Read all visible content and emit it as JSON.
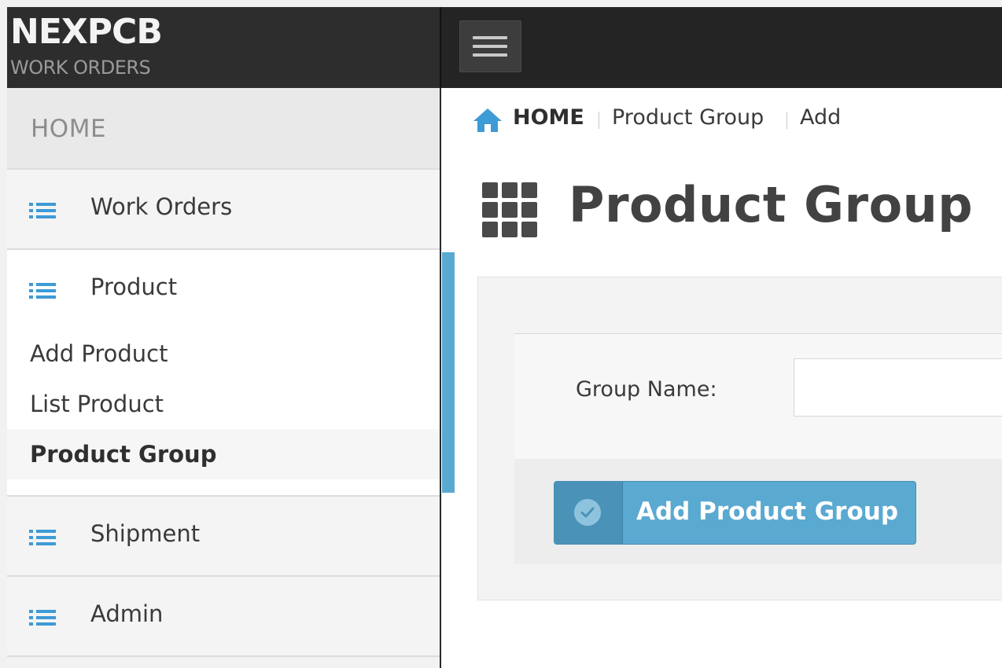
{
  "brand": {
    "name": "NEXPCB",
    "subtitle": "WORK ORDERS"
  },
  "breadcrumb": {
    "home": "HOME",
    "section": "Product Group",
    "action": "Add"
  },
  "sidebar": {
    "home_label": "HOME",
    "items": [
      {
        "label": "Work Orders"
      },
      {
        "label": "Product",
        "children": [
          "Add Product",
          "List Product",
          "Product Group"
        ],
        "active_child": "Product Group"
      },
      {
        "label": "Shipment"
      },
      {
        "label": "Admin"
      }
    ]
  },
  "page": {
    "title": "Product Group"
  },
  "form": {
    "group_name_label": "Group Name:",
    "group_name_value": "",
    "submit_label": "Add Product Group"
  },
  "colors": {
    "accent": "#5aa9d1",
    "list_icon": "#3d9bd6",
    "topbar": "#242424"
  }
}
